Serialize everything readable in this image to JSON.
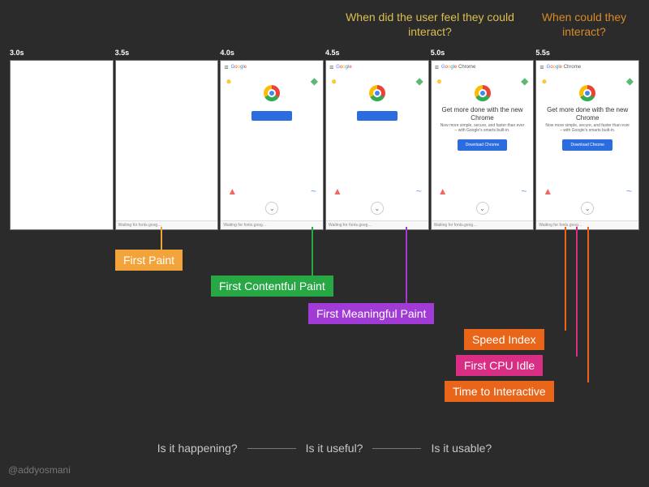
{
  "questions": {
    "feel": "When did the user feel they could interact?",
    "could": "When could they interact?"
  },
  "timestamps": [
    "3.0s",
    "3.5s",
    "4.0s",
    "4.5s",
    "5.0s",
    "5.5s"
  ],
  "screenshots": {
    "logoPlain": "Google",
    "logoChrome": "Google Chrome",
    "heroTitle": "Get more done with the new Chrome",
    "heroSub": "Now more simple, secure, and faster than ever – with Google's smarts built-in.",
    "heroBtn": "Download Chrome",
    "status": "Waiting for fonts.goog…"
  },
  "metrics": {
    "fp": "First Paint",
    "fcp": "First Contentful Paint",
    "fmp": "First Meaningful Paint",
    "si": "Speed Index",
    "fci": "First CPU Idle",
    "tti": "Time to Interactive"
  },
  "bottom": {
    "q1": "Is it happening?",
    "q2": "Is it useful?",
    "q3": "Is it usable?"
  },
  "credit": "@addyosmani"
}
